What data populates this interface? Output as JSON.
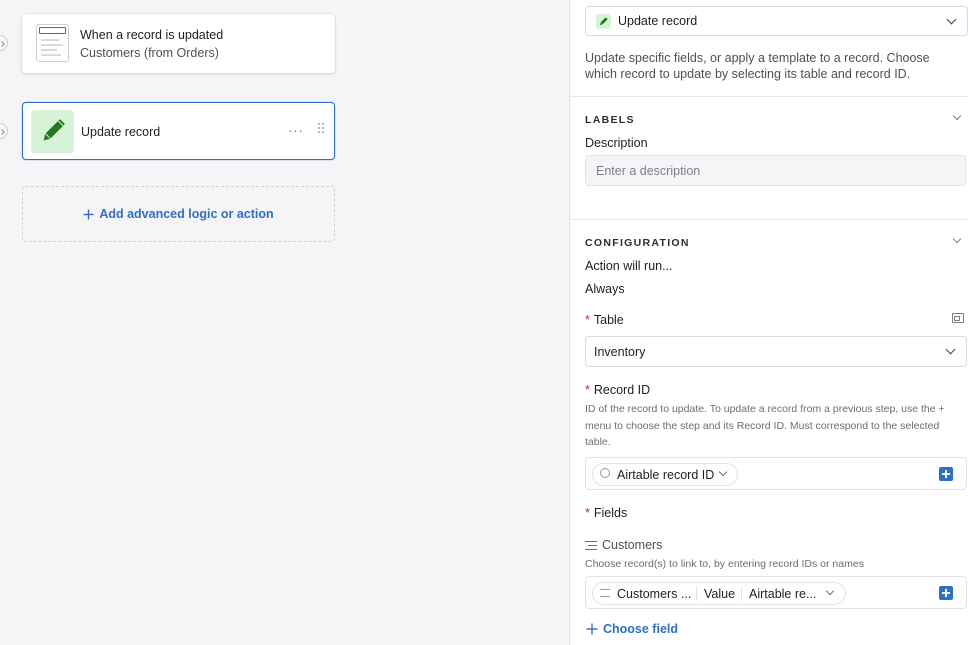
{
  "canvas": {
    "trigger": {
      "title": "When a record is updated",
      "subtitle": "Customers (from Orders)"
    },
    "action": {
      "title": "Update record",
      "menu_glyph": "···"
    },
    "add_logic_label": "Add advanced logic or action"
  },
  "panel": {
    "action_select": {
      "value": "Update record"
    },
    "description": "Update specific fields, or apply a template to a record. Choose which record to update by selecting its table and record ID.",
    "labels_section": {
      "title": "LABELS",
      "description_label": "Description",
      "description_placeholder": "Enter a description"
    },
    "configuration_section": {
      "title": "CONFIGURATION",
      "action_will_run_label": "Action will run...",
      "action_will_run_value": "Always",
      "table": {
        "label": "Table",
        "value": "Inventory"
      },
      "record_id": {
        "label": "Record ID",
        "help_line1": "ID of the record to update. To update a record from a previous step, use the +",
        "help_line2": "menu to choose the step and its Record ID. Must correspond to the selected",
        "help_line3": "table.",
        "token_label": "Airtable record ID"
      },
      "fields": {
        "label": "Fields",
        "field_name": "Customers",
        "field_help": "Choose record(s) to link to, by entering record IDs or names",
        "token_parts": [
          "Customers ...",
          "Value",
          "Airtable re..."
        ]
      },
      "choose_field_label": "Choose field"
    }
  },
  "colors": {
    "accent": "#2d6fc9",
    "action_icon_bg": "#d7f2d4",
    "action_icon_fg": "#1f7a1f",
    "required": "#c32b2b",
    "canvas_bg": "#f5f5f7"
  },
  "icons": {
    "trigger": "record-form-icon",
    "action": "pencil-icon",
    "menu": "more-icon",
    "drag": "drag-handle-icon",
    "add": "plus-icon",
    "chevron": "chevron-down-icon",
    "record_id_token": "at-sign-icon",
    "linked_field": "linked-records-icon",
    "insert": "plus-square-icon",
    "field_layout": "layout-icon"
  }
}
